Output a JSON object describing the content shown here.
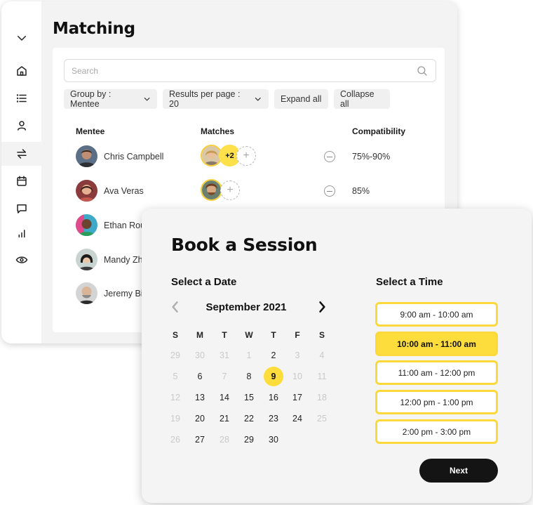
{
  "matching": {
    "title": "Matching",
    "search": {
      "placeholder": "Search"
    },
    "controls": {
      "group_by": "Group by : Mentee",
      "results_per_page": "Results per page : 20",
      "expand_all": "Expand all",
      "collapse_all": "Collapse all"
    },
    "columns": {
      "mentee": "Mentee",
      "matches": "Matches",
      "compatibility": "Compatibility"
    },
    "rows": [
      {
        "name": "Chris Campbell",
        "extra_matches": "+2",
        "compatibility": "75%-90%"
      },
      {
        "name": "Ava Veras",
        "compatibility": "85%"
      },
      {
        "name": "Ethan Rou"
      },
      {
        "name": "Mandy Zho"
      },
      {
        "name": "Jeremy Bis"
      }
    ]
  },
  "sidebar": {
    "icons": [
      "chevron-down-icon",
      "home-icon",
      "list-icon",
      "user-icon",
      "match-arrows-icon",
      "calendar-icon",
      "chat-icon",
      "bar-chart-icon",
      "eye-icon"
    ],
    "active": "match-arrows-icon"
  },
  "booking": {
    "title": "Book a Session",
    "date_label": "Select a Date",
    "time_label": "Select a Time",
    "month": "September 2021",
    "weekdays": [
      "S",
      "M",
      "T",
      "W",
      "T",
      "F",
      "S"
    ],
    "selected_day": "9",
    "slots": [
      "9:00 am - 10:00 am",
      "10:00 am - 11:00 am",
      "11:00 am - 12:00 pm",
      "12:00 pm - 1:00 pm",
      "2:00 pm - 3:00 pm"
    ],
    "selected_slot": "10:00 am - 11:00 am",
    "next_label": "Next"
  },
  "colors": {
    "accent": "#fddd3b",
    "button": "#141414"
  }
}
